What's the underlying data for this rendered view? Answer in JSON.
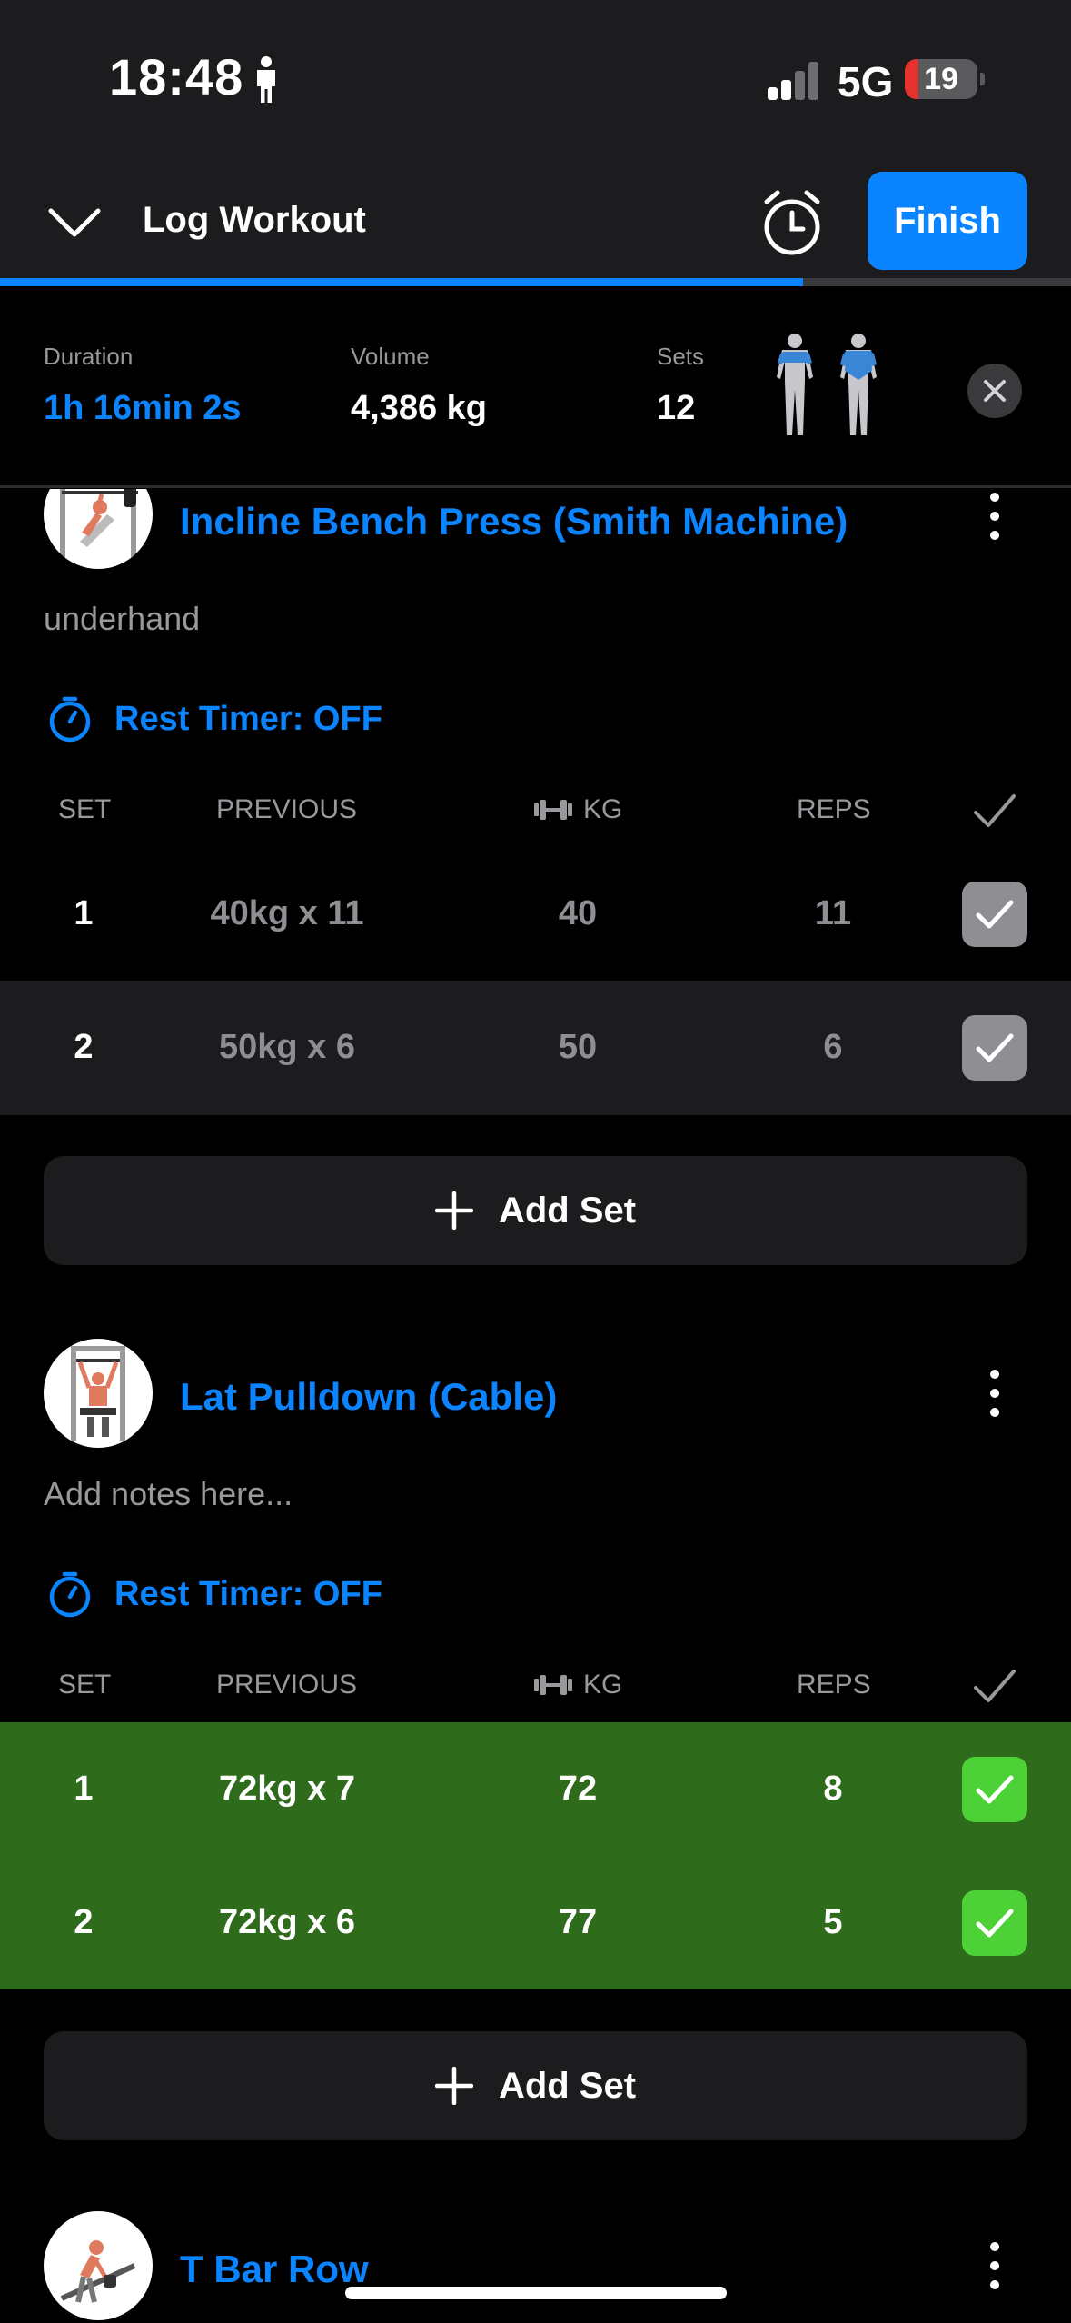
{
  "status_bar": {
    "time": "18:48",
    "network": "5G",
    "battery": "19",
    "battery_level": 0.19
  },
  "header": {
    "title": "Log Workout",
    "finish_label": "Finish",
    "progress": 0.75
  },
  "summary": {
    "duration_label": "Duration",
    "duration_value": "1h 16min 2s",
    "volume_label": "Volume",
    "volume_value": "4,386 kg",
    "sets_label": "Sets",
    "sets_value": "12"
  },
  "columns": {
    "set": "SET",
    "previous": "PREVIOUS",
    "kg": "KG",
    "reps": "REPS"
  },
  "exercises": [
    {
      "name": "Incline Bench Press (Smith Machine)",
      "note": "underhand",
      "rest_timer": "Rest Timer: OFF",
      "sets": [
        {
          "set": "1",
          "previous": "40kg x 11",
          "kg": "40",
          "reps": "11",
          "completed": true
        },
        {
          "set": "2",
          "previous": "50kg x 6",
          "kg": "50",
          "reps": "6",
          "completed": true
        }
      ],
      "add_set_label": "Add Set"
    },
    {
      "name": "Lat Pulldown (Cable)",
      "note_placeholder": "Add notes here...",
      "rest_timer": "Rest Timer: OFF",
      "sets": [
        {
          "set": "1",
          "previous": "72kg x 7",
          "kg": "72",
          "reps": "8",
          "completed": true
        },
        {
          "set": "2",
          "previous": "72kg x 6",
          "kg": "77",
          "reps": "5",
          "completed": true
        }
      ],
      "add_set_label": "Add Set"
    },
    {
      "name": "T Bar Row"
    }
  ],
  "colors": {
    "accent": "#0a84ff",
    "completed_row": "#2e6b1a",
    "completed_check": "#4cd137",
    "background": "#000000",
    "surface": "#1c1c1e"
  }
}
